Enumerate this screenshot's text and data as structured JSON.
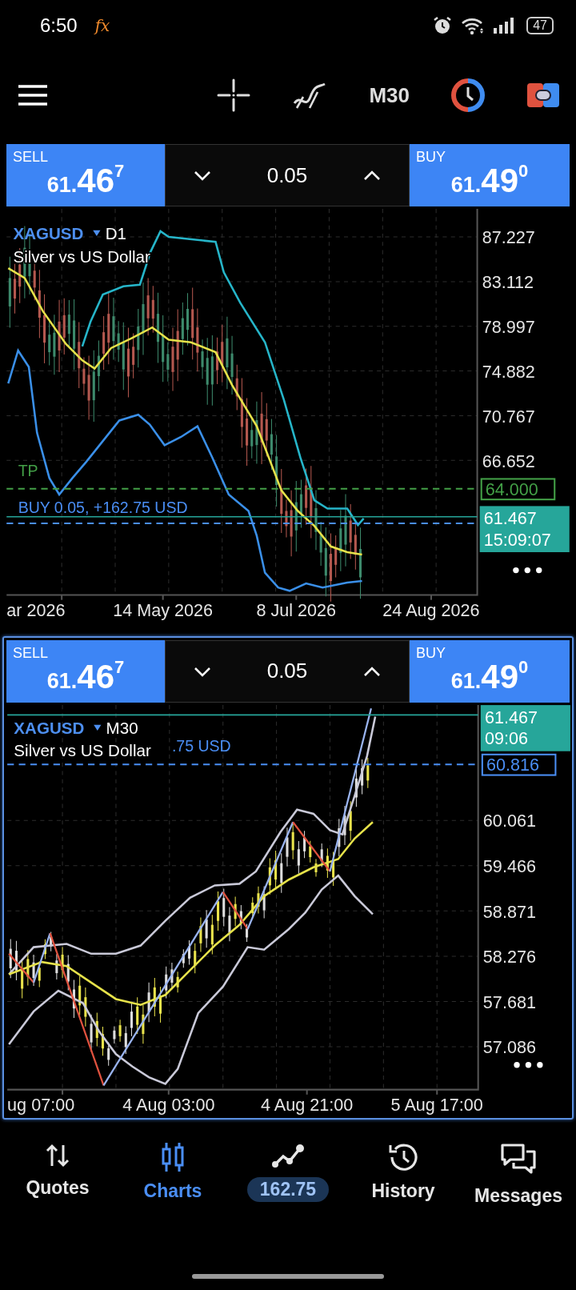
{
  "status_bar": {
    "time": "6:50",
    "notification": "fx",
    "battery": "47"
  },
  "toolbar": {
    "timeframe": "M30"
  },
  "charts": [
    {
      "selected": false,
      "trade_panel": {
        "sell": {
          "label": "SELL",
          "price_prefix": "61.",
          "price_main": "46",
          "price_sup": "7"
        },
        "lot": "0.05",
        "buy": {
          "label": "BUY",
          "price_prefix": "61.",
          "price_main": "49",
          "price_sup": "0"
        }
      },
      "symbol": "XAGUSD",
      "timeframe": "D1",
      "description": "Silver vs US Dollar",
      "price_labels": [
        "87.227",
        "83.112",
        "78.997",
        "74.882",
        "70.767",
        "66.652"
      ],
      "time_labels": [
        "ar 2026",
        "14 May 2026",
        "8 Jul 2026",
        "24 Aug 2026"
      ],
      "lines": [
        {
          "kind": "tp",
          "label": "TP",
          "badge": "64.000"
        },
        {
          "kind": "position",
          "label": "BUY 0.05,  +162.75 USD"
        }
      ],
      "price_badge": {
        "price": "61.467",
        "time": "15:09:07"
      }
    },
    {
      "selected": true,
      "trade_panel": {
        "sell": {
          "label": "SELL",
          "price_prefix": "61.",
          "price_main": "46",
          "price_sup": "7"
        },
        "lot": "0.05",
        "buy": {
          "label": "BUY",
          "price_prefix": "61.",
          "price_main": "49",
          "price_sup": "0"
        }
      },
      "symbol": "XAGUSD",
      "timeframe": "M30",
      "description": "Silver vs US Dollar",
      "price_labels": [
        "60.061",
        "59.466",
        "58.871",
        "58.276",
        "57.681",
        "57.086"
      ],
      "time_labels": [
        "ug 07:00",
        "4 Aug 03:00",
        "4 Aug 21:00",
        "5 Aug 17:00"
      ],
      "lines": [
        {
          "kind": "position",
          "label": ".75 USD",
          "badge": "60.816"
        }
      ],
      "price_badge": {
        "price": "61.467",
        "time": "09:06"
      }
    }
  ],
  "nav": [
    {
      "kind": "tab",
      "label": "Quotes",
      "selected": false
    },
    {
      "kind": "tab",
      "label": "Charts",
      "selected": true
    },
    {
      "kind": "profit",
      "label": "162.75",
      "selected": false
    },
    {
      "kind": "tab",
      "label": "History",
      "selected": false
    },
    {
      "kind": "tab",
      "label": "Messages",
      "selected": false
    }
  ]
}
